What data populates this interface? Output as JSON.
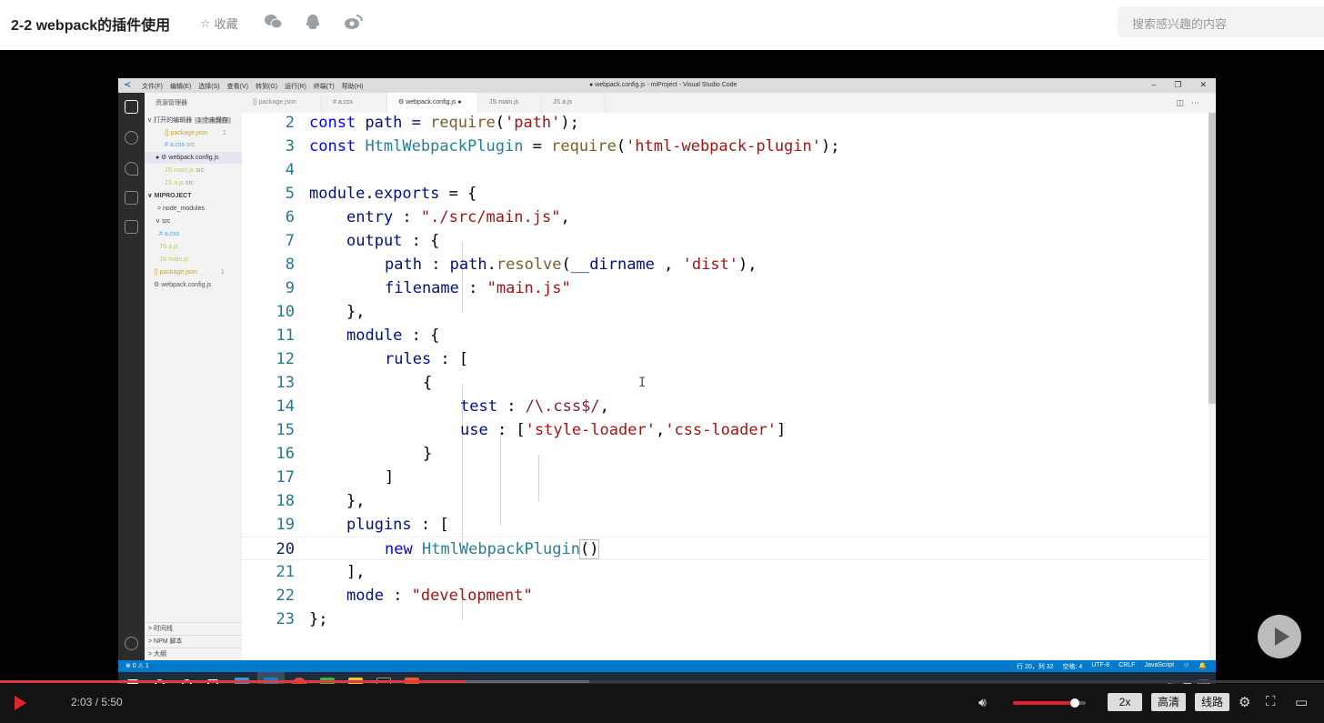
{
  "page": {
    "title": "2-2 webpack的插件使用",
    "favorite_label": "收藏",
    "search_placeholder": "搜索感兴趣的内容"
  },
  "share": {
    "icons": [
      "wechat-icon",
      "qq-icon",
      "weibo-icon"
    ]
  },
  "vscode": {
    "menu": [
      "文件(F)",
      "编辑(E)",
      "选择(S)",
      "查看(V)",
      "转到(G)",
      "运行(R)",
      "终端(T)",
      "帮助(H)"
    ],
    "window_title": "● webpack.config.js - miProject - Visual Studio Code",
    "explorer_title": "资源管理器",
    "open_editors_label": "打开的编辑器",
    "open_editors_badge": "1 个未保存",
    "open_editors": [
      {
        "name": "{} package.json",
        "extra": "1"
      },
      {
        "name": "# a.css",
        "extra": "src"
      },
      {
        "name": "● ⚙ webpack.config.js",
        "extra": ""
      },
      {
        "name": "JS main.js",
        "extra": "src"
      },
      {
        "name": "JS a.js",
        "extra": "src"
      }
    ],
    "project_label": "MIPROJECT",
    "tree": [
      {
        "name": "> node_modules",
        "extra": ""
      },
      {
        "name": "∨ src",
        "extra": ""
      },
      {
        "name": "# a.css",
        "extra": ""
      },
      {
        "name": "JS a.js",
        "extra": ""
      },
      {
        "name": "JS main.js",
        "extra": ""
      },
      {
        "name": "{} package.json",
        "extra": "1"
      },
      {
        "name": "⚙ webpack.config.js",
        "extra": ""
      }
    ],
    "bottom_panels": [
      "> 时间线",
      "> NPM 脚本",
      "> 大纲"
    ],
    "tabs": [
      "{} package.json",
      "# a.css",
      "⚙ webpack.config.js ●",
      "JS main.js",
      "JS a.js"
    ],
    "status_left": "⊗ 0 ⚠ 1",
    "status_right": [
      "行 20，列 32",
      "空格: 4",
      "UTF-8",
      "CRLF",
      "JavaScript"
    ],
    "code_lines": [
      {
        "n": "2"
      },
      {
        "n": "3"
      },
      {
        "n": "4"
      },
      {
        "n": "5"
      },
      {
        "n": "6"
      },
      {
        "n": "7"
      },
      {
        "n": "8"
      },
      {
        "n": "9"
      },
      {
        "n": "10"
      },
      {
        "n": "11"
      },
      {
        "n": "12"
      },
      {
        "n": "13"
      },
      {
        "n": "14"
      },
      {
        "n": "15"
      },
      {
        "n": "16"
      },
      {
        "n": "17"
      },
      {
        "n": "18"
      },
      {
        "n": "19"
      },
      {
        "n": "20"
      },
      {
        "n": "21"
      },
      {
        "n": "22"
      },
      {
        "n": "23"
      }
    ],
    "code": {
      "l2": [
        "const",
        " path = ",
        "require",
        "(",
        "'path'",
        ");"
      ],
      "l3": [
        "const",
        " ",
        "HtmlWebpackPlugin",
        " = ",
        "require",
        "(",
        "'html-webpack-plugin'",
        ");"
      ],
      "l5": [
        "module",
        ".",
        "exports",
        " = {"
      ],
      "l6": [
        "entry",
        " : ",
        "\"./src/main.js\"",
        ","
      ],
      "l7": [
        "output",
        " : {"
      ],
      "l8": [
        "path",
        " : ",
        "path",
        ".",
        "resolve",
        "(",
        "__dirname",
        " , ",
        "'dist'",
        "),"
      ],
      "l9": [
        "filename",
        " : ",
        "\"main.js\""
      ],
      "l10": [
        "},"
      ],
      "l11": [
        "module",
        " : {"
      ],
      "l12": [
        "rules",
        " : ["
      ],
      "l13": [
        "{"
      ],
      "l14": [
        "test",
        " : ",
        "/\\.css$/",
        ","
      ],
      "l15": [
        "use",
        " : [",
        "'style-loader'",
        ",",
        "'css-loader'",
        "]"
      ],
      "l16": [
        "}"
      ],
      "l17": [
        "]"
      ],
      "l18": [
        "},"
      ],
      "l19": [
        "plugins",
        " : ["
      ],
      "l20": [
        "new",
        " ",
        "HtmlWebpackPlugin",
        "()"
      ],
      "l21": [
        "],"
      ],
      "l22": [
        "mode",
        " : ",
        "\"development\""
      ],
      "l23": [
        "};"
      ]
    }
  },
  "player": {
    "current_time": "2:03",
    "duration": "5:50",
    "time_display": "2:03 / 5:50",
    "progress_fraction": 0.351,
    "buffered_fraction": 0.445,
    "volume_fraction": 0.85,
    "speed_label": "2x",
    "quality_label": "高清",
    "route_label": "线路",
    "colors": {
      "accent": "#e0242a",
      "vscode_status": "#007acc"
    }
  }
}
